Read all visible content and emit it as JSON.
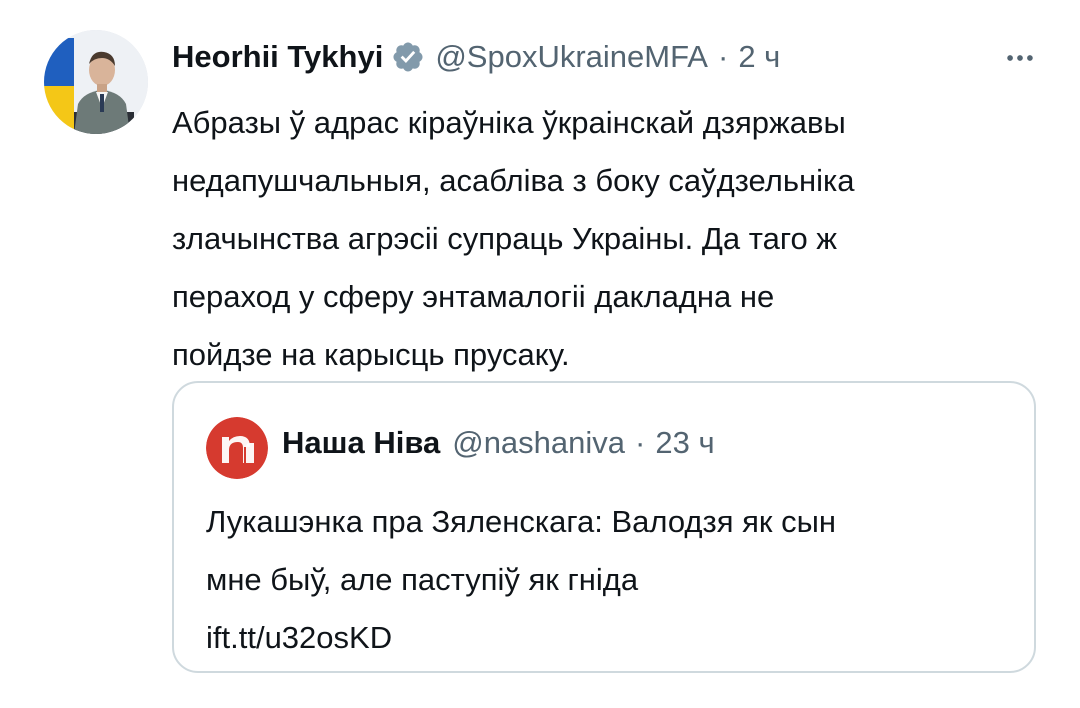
{
  "tweet": {
    "author_name": "Heorhii Tykhyi",
    "handle": "@SpoxUkraineMFA",
    "separator": "·",
    "time": "2 ч",
    "more_icon": "more-horizontal-icon",
    "verified_icon": "verified-badge-icon",
    "text_lines": [
      "Абразы ў адрас кіраўніка ўкраінскай дзяржавы",
      "недапушчальныя, асабліва з боку саўдзельніка",
      "злачынства агрэсіі супраць Украіны. Да таго ж",
      "пераход у сферу энтамалогіі дакладна не",
      "пойдзе на карысць прусаку."
    ]
  },
  "quote": {
    "author_name": "Наша Ніва",
    "handle": "@nashaniva",
    "separator": "·",
    "time": "23 ч",
    "text_lines": [
      "Лукашэнка пра Зяленскага: Валодзя як сын",
      "мне быў, але паступіў як гніда",
      "ift.tt/u32osKD"
    ]
  },
  "colors": {
    "text_primary": "#0f1419",
    "text_secondary": "#536471",
    "verified": "#829aab",
    "border": "#cfd9de",
    "nashaniva_red": "#d63a2f"
  }
}
